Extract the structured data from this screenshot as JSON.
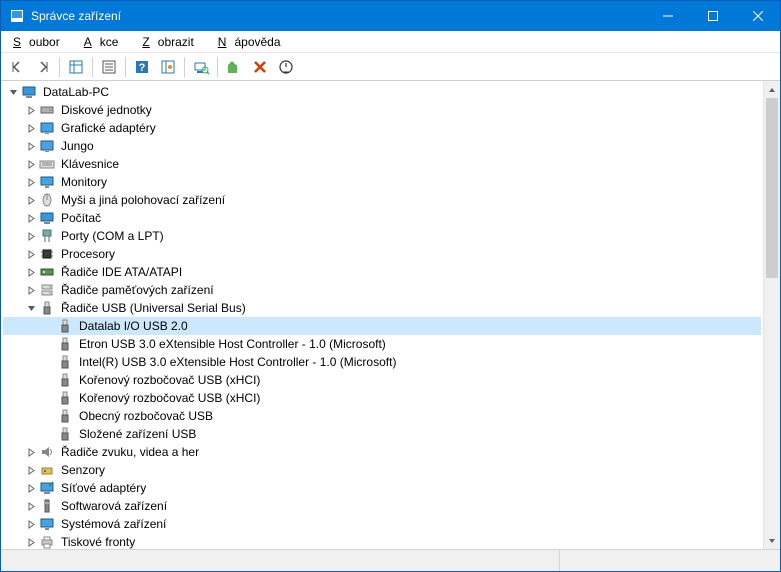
{
  "window": {
    "title": "Správce zařízení"
  },
  "menu": {
    "file": "Soubor",
    "file_u": "S",
    "action": "Akce",
    "action_u": "A",
    "view": "Zobrazit",
    "view_u": "Z",
    "help": "Nápověda",
    "help_u": "N"
  },
  "tree": {
    "root": "DataLab-PC",
    "items": [
      {
        "label": "Diskové jednotky",
        "icon": "disk"
      },
      {
        "label": "Grafické adaptéry",
        "icon": "display"
      },
      {
        "label": "Jungo",
        "icon": "display"
      },
      {
        "label": "Klávesnice",
        "icon": "keyboard"
      },
      {
        "label": "Monitory",
        "icon": "monitor"
      },
      {
        "label": "Myši a jiná polohovací zařízení",
        "icon": "mouse"
      },
      {
        "label": "Počítač",
        "icon": "computer"
      },
      {
        "label": "Porty (COM a LPT)",
        "icon": "port"
      },
      {
        "label": "Procesory",
        "icon": "cpu"
      },
      {
        "label": "Řadiče IDE ATA/ATAPI",
        "icon": "ide"
      },
      {
        "label": "Řadiče paměťových zařízení",
        "icon": "storage"
      }
    ],
    "usb": {
      "label": "Řadiče USB (Universal Serial Bus)",
      "children": [
        {
          "label": "Datalab I/O USB 2.0",
          "selected": true
        },
        {
          "label": "Etron USB 3.0 eXtensible Host Controller - 1.0 (Microsoft)"
        },
        {
          "label": "Intel(R) USB 3.0 eXtensible Host Controller - 1.0 (Microsoft)"
        },
        {
          "label": "Kořenový rozbočovač USB (xHCI)"
        },
        {
          "label": "Kořenový rozbočovač USB (xHCI)"
        },
        {
          "label": "Obecný rozbočovač USB"
        },
        {
          "label": "Složené zařízení USB"
        }
      ]
    },
    "after": [
      {
        "label": "Řadiče zvuku, videa a her",
        "icon": "sound"
      },
      {
        "label": "Senzory",
        "icon": "sensor"
      },
      {
        "label": "Síťové adaptéry",
        "icon": "network"
      },
      {
        "label": "Softwarová zařízení",
        "icon": "software"
      },
      {
        "label": "Systémová zařízení",
        "icon": "system"
      },
      {
        "label": "Tiskové fronty",
        "icon": "printer"
      }
    ]
  }
}
